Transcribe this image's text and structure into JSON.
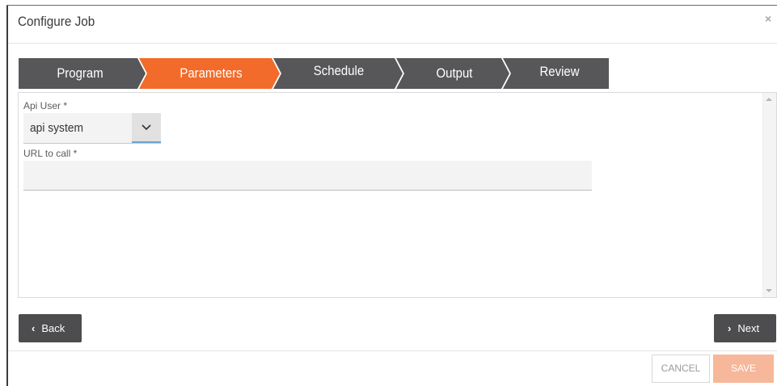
{
  "dialog": {
    "title": "Configure Job",
    "close_symbol": "×"
  },
  "wizard": {
    "steps": [
      {
        "label": "Program",
        "active": false
      },
      {
        "label": "Parameters",
        "active": true
      },
      {
        "label": "Schedule",
        "active": false
      },
      {
        "label": "Output",
        "active": false
      },
      {
        "label": "Review",
        "active": false
      }
    ],
    "colors": {
      "active": "#f26b2a",
      "inactive": "#57575a"
    }
  },
  "form": {
    "api_user": {
      "label": "Api User *",
      "value": "api system"
    },
    "url": {
      "label": "URL to call *",
      "value": "",
      "placeholder": ""
    }
  },
  "navigation": {
    "back_label": "Back",
    "next_label": "Next"
  },
  "footer": {
    "cancel_label": "CANCEL",
    "save_label": "SAVE"
  },
  "icons": {
    "close": "close-icon",
    "select_arrow": "chevron-down-icon",
    "back": "chevron-left-icon",
    "next": "chevron-right-icon"
  }
}
